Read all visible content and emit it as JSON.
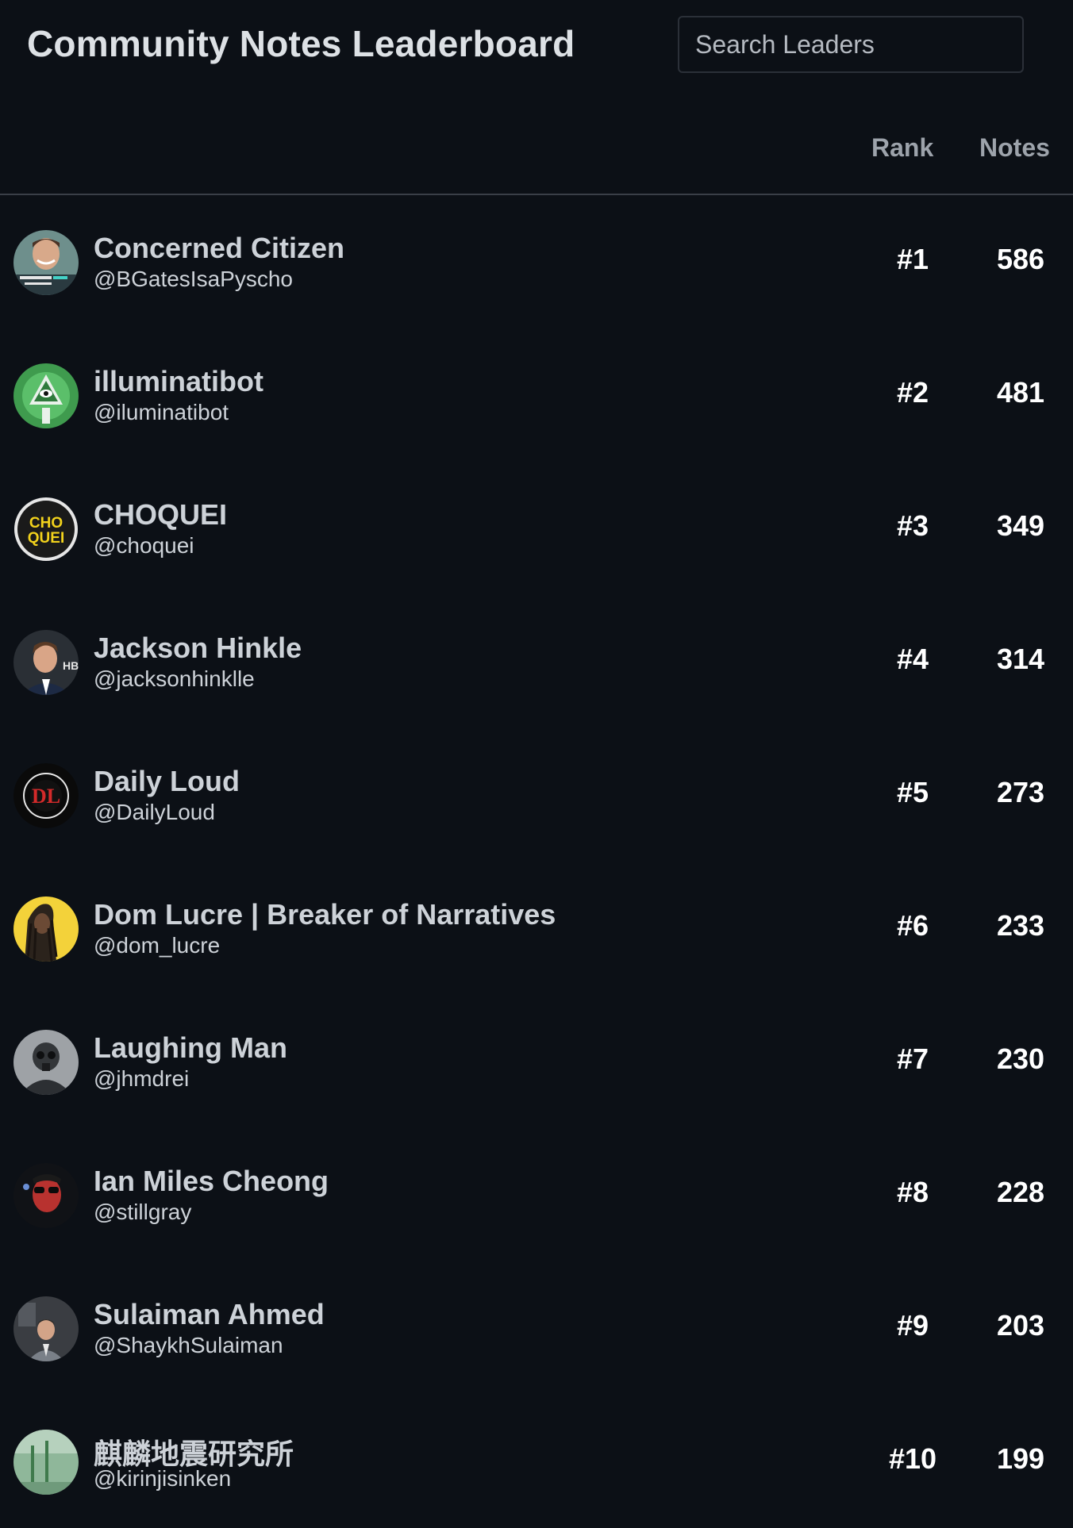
{
  "header": {
    "title": "Community Notes Leaderboard",
    "search_placeholder": "Search Leaders"
  },
  "columns": {
    "rank": "Rank",
    "notes": "Notes"
  },
  "leaders": [
    {
      "name": "Concerned Citizen",
      "handle": "@BGatesIsaPyscho",
      "rank": "#1",
      "notes": "586",
      "avatar_icon": "person-photo-avatar-icon"
    },
    {
      "name": "illuminatibot",
      "handle": "@iluminatibot",
      "rank": "#2",
      "notes": "481",
      "avatar_icon": "eye-pyramid-avatar-icon"
    },
    {
      "name": "CHOQUEI",
      "handle": "@choquei",
      "rank": "#3",
      "notes": "349",
      "avatar_icon": "choquei-logo-avatar-icon"
    },
    {
      "name": "Jackson Hinkle",
      "handle": "@jacksonhinklle",
      "rank": "#4",
      "notes": "314",
      "avatar_icon": "person-photo-avatar-icon"
    },
    {
      "name": "Daily Loud",
      "handle": "@DailyLoud",
      "rank": "#5",
      "notes": "273",
      "avatar_icon": "daily-loud-logo-avatar-icon"
    },
    {
      "name": "Dom Lucre | Breaker of Narratives",
      "handle": "@dom_lucre",
      "rank": "#6",
      "notes": "233",
      "avatar_icon": "person-yellow-avatar-icon"
    },
    {
      "name": "Laughing Man",
      "handle": "@jhmdrei",
      "rank": "#7",
      "notes": "230",
      "avatar_icon": "masked-soldier-avatar-icon"
    },
    {
      "name": "Ian Miles Cheong",
      "handle": "@stillgray",
      "rank": "#8",
      "notes": "228",
      "avatar_icon": "person-sunglasses-avatar-icon"
    },
    {
      "name": "Sulaiman Ahmed",
      "handle": "@ShaykhSulaiman",
      "rank": "#9",
      "notes": "203",
      "avatar_icon": "person-suit-avatar-icon"
    },
    {
      "name": "麒麟地震研究所",
      "handle": "@kirinjisinken",
      "rank": "#10",
      "notes": "199",
      "avatar_icon": "green-landscape-avatar-icon"
    }
  ],
  "colors": {
    "background": "#0c1016",
    "text": "#cdd2d8",
    "header_text": "#9da3ab",
    "divider": "#3a3f47"
  }
}
